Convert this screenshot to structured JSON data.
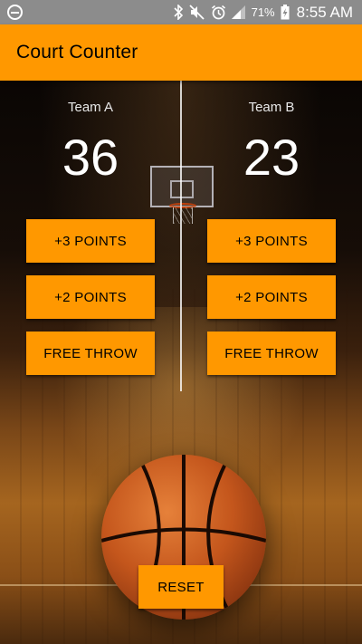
{
  "status_bar": {
    "battery_percent": "71%",
    "time": "8:55 AM",
    "icons": [
      "do-not-disturb-icon",
      "bluetooth-icon",
      "mute-icon",
      "alarm-icon",
      "signal-icon",
      "battery-charging-icon"
    ]
  },
  "app_bar": {
    "title": "Court Counter",
    "color": "#ff9800"
  },
  "team_a": {
    "name": "Team A",
    "score": "36",
    "buttons": {
      "three": "+3 POINTS",
      "two": "+2 POINTS",
      "free_throw": "FREE THROW"
    }
  },
  "team_b": {
    "name": "Team B",
    "score": "23",
    "buttons": {
      "three": "+3 POINTS",
      "two": "+2 POINTS",
      "free_throw": "FREE THROW"
    }
  },
  "reset_label": "RESET",
  "colors": {
    "accent": "#ff9800",
    "status_bar": "#8c8c8c"
  }
}
